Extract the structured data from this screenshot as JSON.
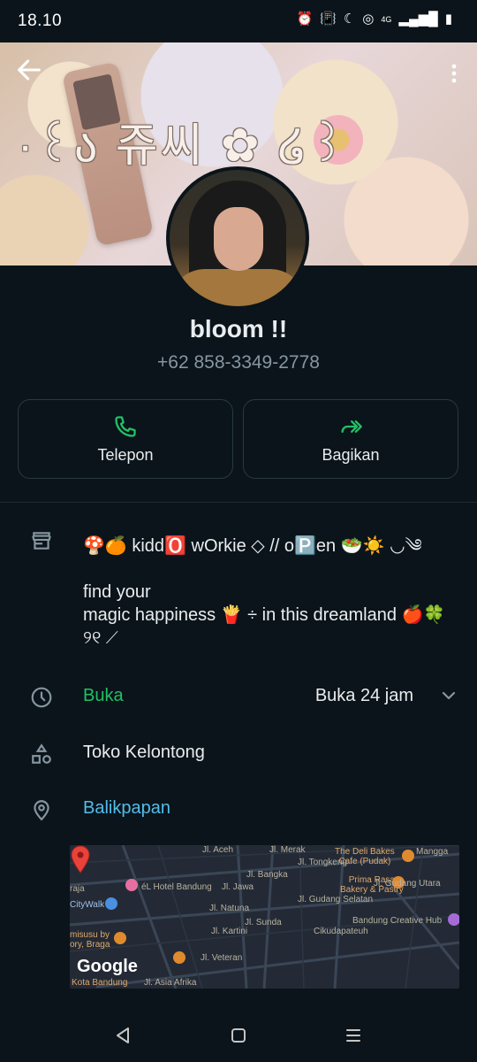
{
  "status_bar": {
    "time": "18.10",
    "network": "4G"
  },
  "cover": {
    "title": "·꒰ა 쥬씨 ✿ ໒꒱"
  },
  "profile": {
    "name": "bloom !!",
    "phone": "+62 858-3349-2778"
  },
  "actions": {
    "call_label": "Telepon",
    "share_label": "Bagikan"
  },
  "business": {
    "description_line1": "🍄🍊 kidd🅾️ wOrkie ◇ // o🅿️en 🥗☀️ ◡༄",
    "description_line2": "find your\nmagic happiness 🍟 ÷ in this dreamland 🍎🍀\n୨୧ ⟋",
    "hours_status": "Buka",
    "hours_text": "Buka 24 jam",
    "category": "Toko Kelontong",
    "location": "Balikpapan"
  },
  "map": {
    "logo": "Google",
    "labels": {
      "deli": "The Deli Bakes\nCafe (Pudak)",
      "prima": "Prima Rasa\nBakery & Pastry",
      "hotel": "éL Hotel Bandung",
      "citywalk": "CityWalk",
      "creative": "Bandung Creative Hub",
      "cikuda": "Cikudapateuh",
      "misusu": "misusu by\nory, Braga",
      "kota": "Kota Bandung",
      "jl_jawa": "Jl. Jawa",
      "jl_natuna": "Jl. Natuna",
      "jl_kartini": "Jl. Kartini",
      "jl_veteran": "Jl. Veteran",
      "jl_sunda": "Jl. Sunda",
      "jl_gudang_selatan": "Jl. Gudang Selatan",
      "jl_gudang_utara": "Jl. Gudang Utara",
      "jl_asia_afrika": "Jl. Asia Afrika",
      "jl_bangka": "Jl. Bangka",
      "jl_tongkeng": "Jl. Tongkeng",
      "jl_merak": "Jl. Merak",
      "jl_aceh": "Jl. Aceh",
      "raja": "raja",
      "mangga": "Mangga"
    }
  },
  "colors": {
    "background": "#0b141a",
    "accent_green": "#21c063",
    "link_blue": "#53bdeb",
    "secondary_text": "#8696a0"
  }
}
